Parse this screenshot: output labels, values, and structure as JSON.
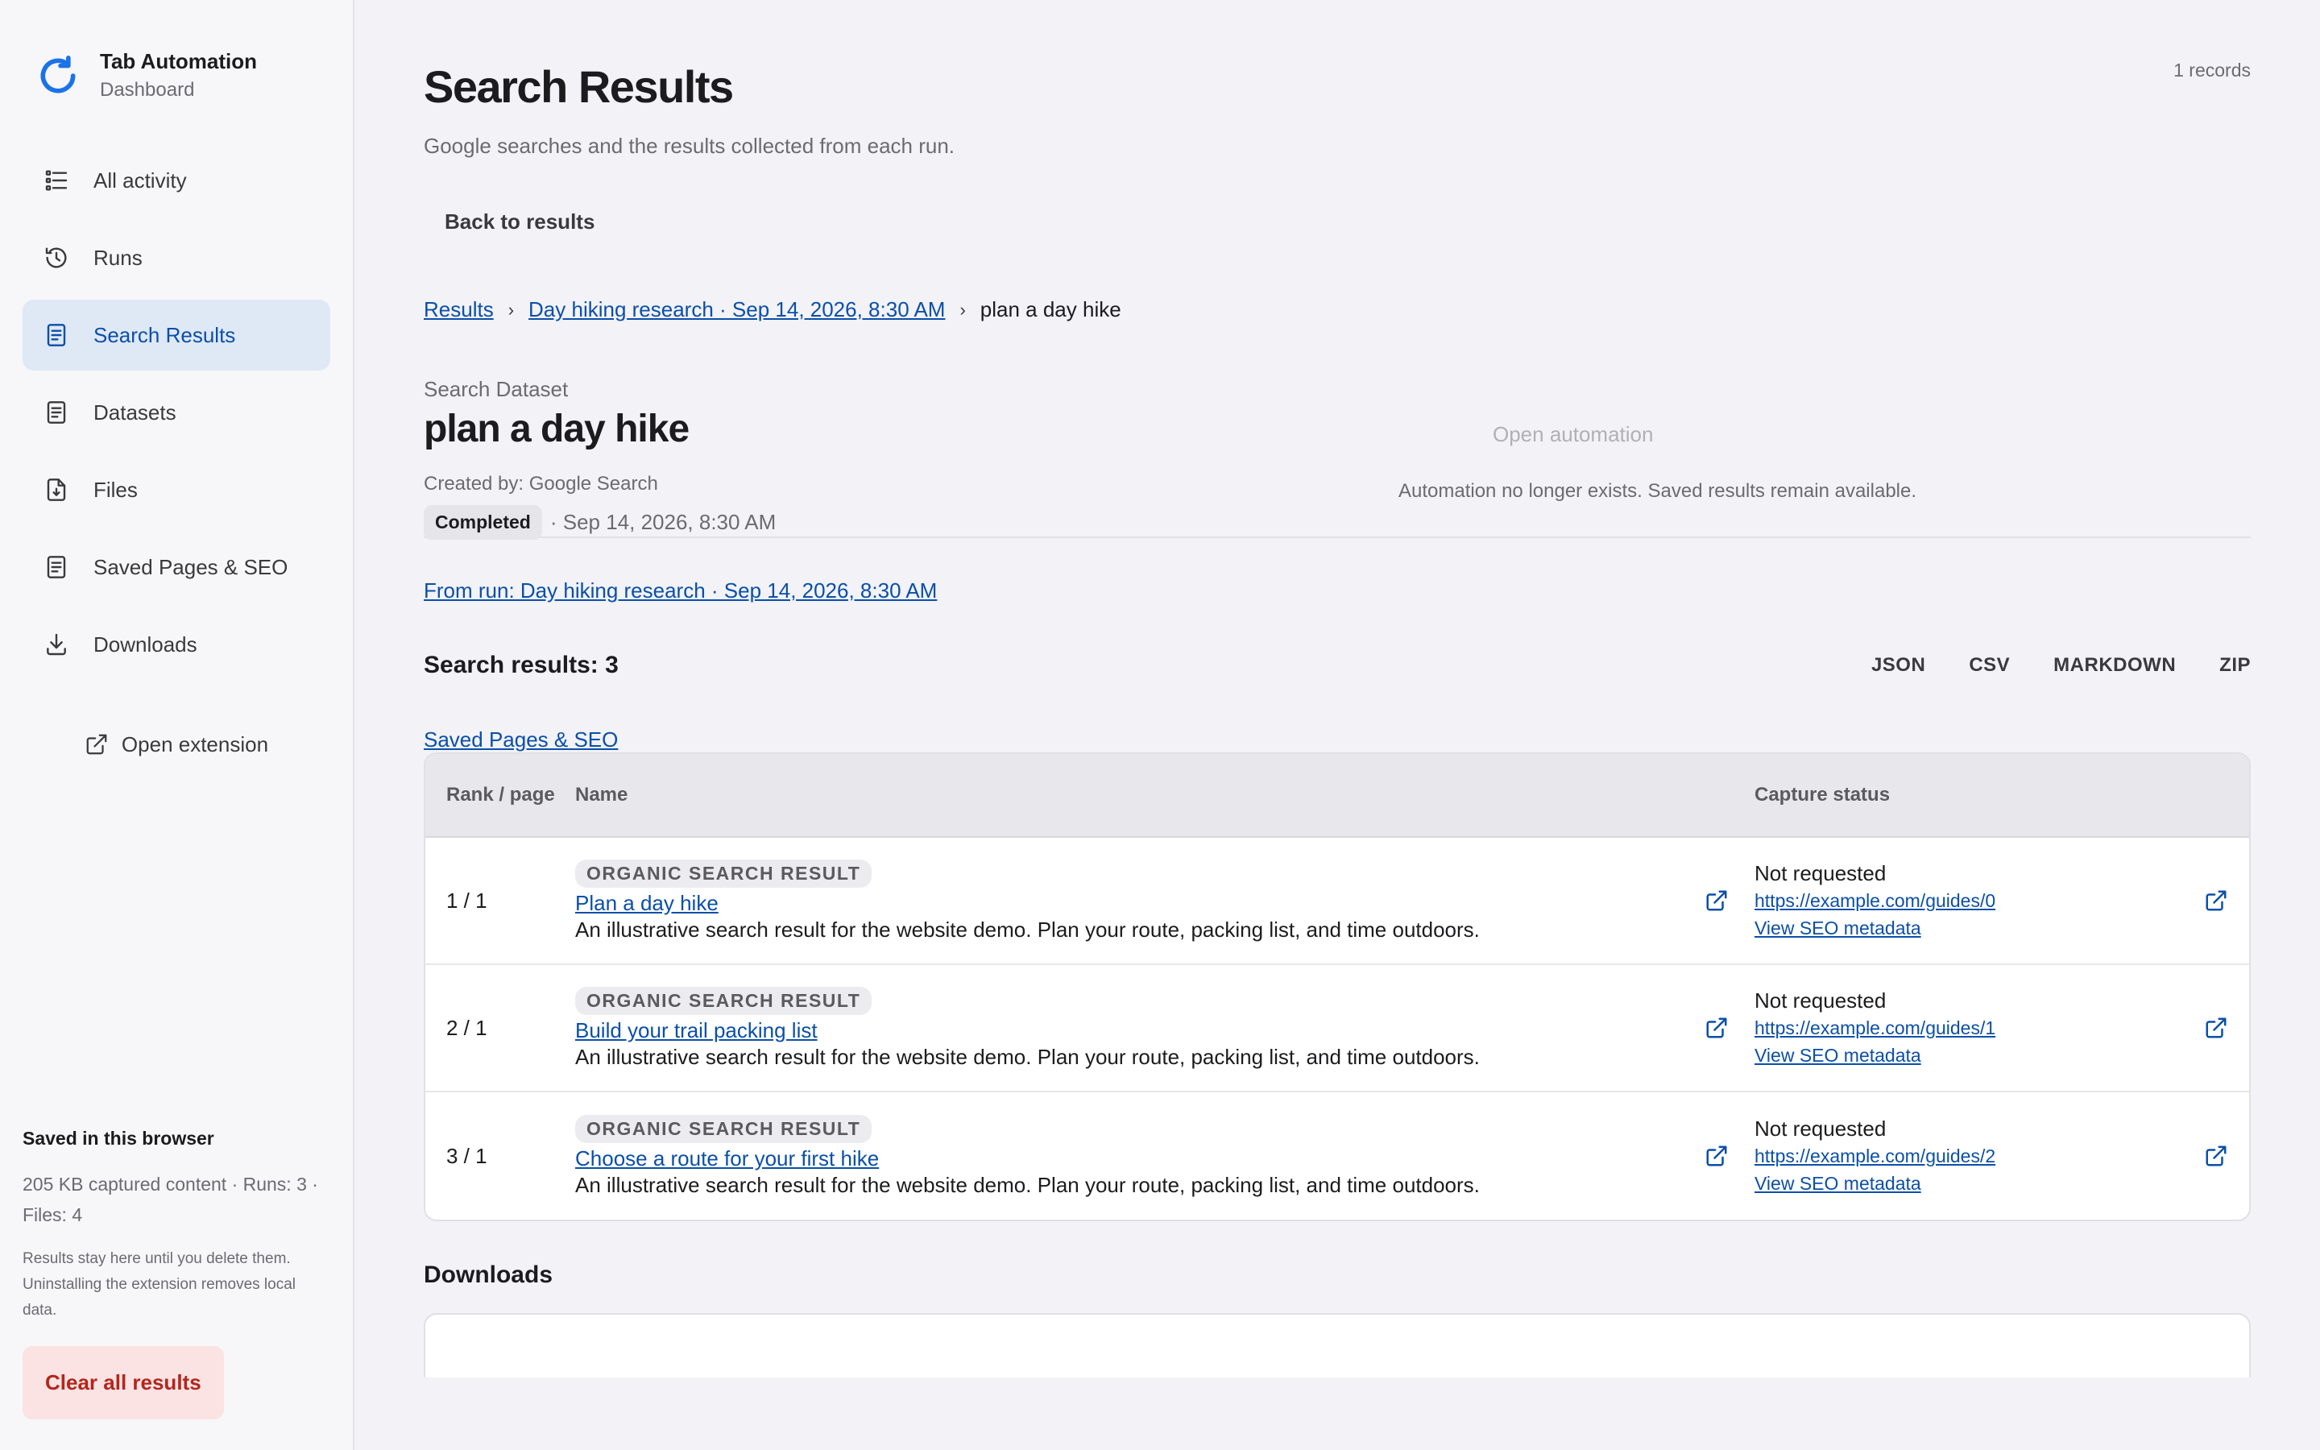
{
  "brand": {
    "title": "Tab Automation",
    "subtitle": "Dashboard"
  },
  "nav": {
    "items": [
      {
        "label": "All activity",
        "icon": "list-icon"
      },
      {
        "label": "Runs",
        "icon": "history-icon"
      },
      {
        "label": "Search Results",
        "icon": "document-icon",
        "active": true
      },
      {
        "label": "Datasets",
        "icon": "document-icon"
      },
      {
        "label": "Files",
        "icon": "file-download-icon"
      },
      {
        "label": "Saved Pages & SEO",
        "icon": "document-icon"
      },
      {
        "label": "Downloads",
        "icon": "download-icon"
      }
    ],
    "open_extension": "Open extension"
  },
  "storage": {
    "title": "Saved in this browser",
    "stats": "205 KB captured content · Runs: 3 · Files: 4",
    "note": "Results stay here until you delete them. Uninstalling the extension removes local data.",
    "clear_label": "Clear all results"
  },
  "header": {
    "records": "1 records",
    "title": "Search Results",
    "subtitle": "Google searches and the results collected from each run.",
    "back_label": "Back to results"
  },
  "breadcrumb": {
    "root": "Results",
    "run": "Day hiking research · Sep 14, 2026, 8:30 AM",
    "current": "plan a day hike"
  },
  "dataset": {
    "label": "Search Dataset",
    "name": "plan a day hike",
    "created_by": "Created by: Google Search",
    "status": "Completed",
    "timestamp": "· Sep 14, 2026, 8:30 AM",
    "open_automation": "Open automation",
    "automation_note": "Automation no longer exists. Saved results remain available."
  },
  "from_run": "From run: Day hiking research · Sep 14, 2026, 8:30 AM",
  "results": {
    "title": "Search results: 3",
    "exports": [
      "JSON",
      "CSV",
      "MARKDOWN",
      "ZIP"
    ],
    "saved_link": "Saved Pages & SEO",
    "columns": {
      "rank": "Rank / page",
      "name": "Name",
      "status": "Capture status"
    },
    "rows": [
      {
        "rank": "1 / 1",
        "tag": "ORGANIC SEARCH RESULT",
        "title": "Plan a day hike",
        "desc": "An illustrative search result for the website demo. Plan your route, packing list, and time outdoors.",
        "status": "Not requested",
        "url": "https://example.com/guides/0",
        "seo": "View SEO metadata"
      },
      {
        "rank": "2 / 1",
        "tag": "ORGANIC SEARCH RESULT",
        "title": "Build your trail packing list",
        "desc": "An illustrative search result for the website demo. Plan your route, packing list, and time outdoors.",
        "status": "Not requested",
        "url": "https://example.com/guides/1",
        "seo": "View SEO metadata"
      },
      {
        "rank": "3 / 1",
        "tag": "ORGANIC SEARCH RESULT",
        "title": "Choose a route for your first hike",
        "desc": "An illustrative search result for the website demo. Plan your route, packing list, and time outdoors.",
        "status": "Not requested",
        "url": "https://example.com/guides/2",
        "seo": "View SEO metadata"
      }
    ]
  },
  "downloads": {
    "title": "Downloads"
  },
  "colors": {
    "accent": "#0b4fa8",
    "active_bg": "#dfe8f5",
    "danger": "#b3261e",
    "danger_bg": "#fbe3e3"
  }
}
